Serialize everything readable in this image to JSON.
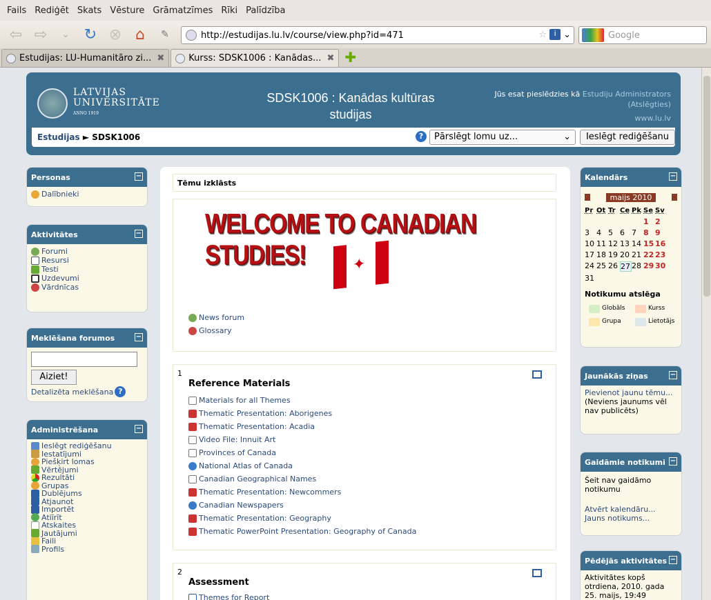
{
  "menu": {
    "items": [
      "Fails",
      "Rediģēt",
      "Skats",
      "Vēsture",
      "Grāmatzīmes",
      "Rīki",
      "Palīdzība"
    ]
  },
  "browser": {
    "url": "http://estudijas.lu.lv/course/view.php?id=471",
    "search_placeholder": "Google",
    "tabs": [
      {
        "label": "Estudijas: LU-Humanitāro zi...",
        "active": false
      },
      {
        "label": "Kurss: SDSK1006 : Kanādas...",
        "active": true
      }
    ]
  },
  "header": {
    "logo_line1": "LATVIJAS",
    "logo_line2": "UNIVERSITĀTE",
    "logo_line3": "ANNO 1919",
    "course_title": "SDSK1006 : Kanādas kultūras studijas",
    "login_text": "Jūs esat pieslēdzies kā",
    "login_user": "Estudiju Administrators",
    "logout": "(Atslēgties)",
    "site": "www.lu.lv",
    "crumb_root": "Estudijas",
    "crumb_sep": "►",
    "crumb_current": "SDSK1006",
    "role_select": "Pārslēgt lomu uz...",
    "edit_button": "Ieslēgt rediģēšanu"
  },
  "left": {
    "personas": {
      "title": "Personas",
      "items": [
        "Dalībnieki"
      ]
    },
    "aktivitates": {
      "title": "Aktivitātes",
      "items": [
        "Forumi",
        "Resursi",
        "Testi",
        "Uzdevumi",
        "Vārdnīcas"
      ]
    },
    "search": {
      "title": "Meklēšana forumos",
      "button": "Aiziet!",
      "advanced": "Detalizēta meklēšana"
    },
    "admin": {
      "title": "Administrēšana",
      "items": [
        "Ieslēgt rediģēšanu",
        "Iestatījumi",
        "Piešķirt lomas",
        "Vērtējumi",
        "Rezultāti",
        "Grupas",
        "Dublējums",
        "Atjaunot",
        "Importēt",
        "Atiīrīt",
        "Atskaites",
        "Jautājumi",
        "Faili",
        "Profils"
      ]
    }
  },
  "main": {
    "topics_title": "Tēmu izklāsts",
    "welcome": "WELCOME TO CANADIAN STUDIES!",
    "intro_items": [
      "News forum",
      "Glossary"
    ],
    "section1": {
      "num": "1",
      "title": "Reference Materials",
      "items": [
        "Materials for all Themes",
        "Thematic Presentation: Aborigenes",
        "Thematic Presentation: Acadia",
        "Video File: Innuit Art",
        "Provinces of Canada",
        "National Atlas of Canada",
        "Canadian Geographical Names",
        "Thematic Presentation: Newcommers",
        "Canadian Newspapers",
        "Thematic Presentation: Geography",
        "Thematic PowerPoint Presentation: Geography of Canada"
      ]
    },
    "section2": {
      "num": "2",
      "title": "Assessment",
      "items": [
        "Themes for Report"
      ]
    }
  },
  "right": {
    "calendar": {
      "title": "Kalendārs",
      "month": "maijs 2010",
      "weekdays": [
        "Pr",
        "Ot",
        "Tr",
        "Ce",
        "Pk",
        "Se",
        "Sv"
      ],
      "days": [
        "",
        "",
        "",
        "",
        "",
        "1",
        "2",
        "3",
        "4",
        "5",
        "6",
        "7",
        "8",
        "9",
        "10",
        "11",
        "12",
        "13",
        "14",
        "15",
        "16",
        "17",
        "18",
        "19",
        "20",
        "21",
        "22",
        "23",
        "24",
        "25",
        "26",
        "27",
        "28",
        "29",
        "30",
        "31"
      ],
      "today": "27",
      "legend_title": "Notikumu atslēga",
      "legend": [
        "Globāls",
        "Kurss",
        "Grupa",
        "Lietotājs"
      ]
    },
    "news": {
      "title": "Jaunākās ziņas",
      "add": "Pievienot jaunu tēmu...",
      "none": "(Neviens jaunums vēl nav publicēts)"
    },
    "upcoming": {
      "title": "Gaidāmie notikumi",
      "none": "Šeit nav gaidāmo notikumu",
      "open_cal": "Atvērt kalendāru...",
      "new_event": "Jauns notikums..."
    },
    "recent": {
      "title": "Pēdējās aktivitātes",
      "text": "Aktivitātes kopš otrdiena, 2010. gada 25. maijs, 19:49"
    }
  },
  "colors": {
    "header": "#3c6e8f",
    "block_bg": "#fbf8e8",
    "link": "#2a4a7a",
    "weekend": "#c02626"
  }
}
